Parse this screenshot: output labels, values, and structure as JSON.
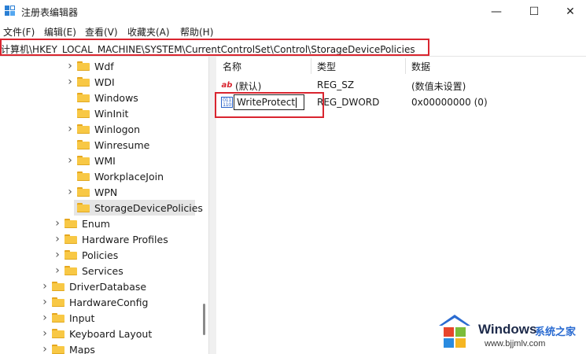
{
  "window": {
    "title": "注册表编辑器",
    "minimize_symbol": "—",
    "maximize_symbol": "☐",
    "close_symbol": "✕"
  },
  "menu": [
    "文件(F)",
    "编辑(E)",
    "查看(V)",
    "收藏夹(A)",
    "帮助(H)"
  ],
  "address": {
    "path": "计算机\\HKEY_LOCAL_MACHINE\\SYSTEM\\CurrentControlSet\\Control\\StorageDevicePolicies"
  },
  "tree": [
    {
      "label": "Wdf",
      "expandable": true
    },
    {
      "label": "WDI",
      "expandable": true
    },
    {
      "label": "Windows",
      "expandable": false
    },
    {
      "label": "WinInit",
      "expandable": false
    },
    {
      "label": "Winlogon",
      "expandable": true
    },
    {
      "label": "Winresume",
      "expandable": false
    },
    {
      "label": "WMI",
      "expandable": true
    },
    {
      "label": "WorkplaceJoin",
      "expandable": false
    },
    {
      "label": "WPN",
      "expandable": true
    },
    {
      "label": "StorageDevicePolicies",
      "expandable": false,
      "selected": true
    },
    {
      "label": "Enum",
      "expandable": true
    },
    {
      "label": "Hardware Profiles",
      "expandable": true
    },
    {
      "label": "Policies",
      "expandable": true
    },
    {
      "label": "Services",
      "expandable": true
    },
    {
      "label": "DriverDatabase",
      "expandable": true
    },
    {
      "label": "HardwareConfig",
      "expandable": true
    },
    {
      "label": "Input",
      "expandable": true
    },
    {
      "label": "Keyboard Layout",
      "expandable": true
    },
    {
      "label": "Maps",
      "expandable": true
    }
  ],
  "values_pane": {
    "columns": [
      "名称",
      "类型",
      "数据"
    ],
    "rows": [
      {
        "icon": "string-value-icon",
        "icon_text": "ab",
        "name": "(默认)",
        "type": "REG_SZ",
        "data": "(数值未设置)"
      },
      {
        "icon": "binary-value-icon",
        "icon_text": "011\n110",
        "name": "WriteProtect",
        "type": "REG_DWORD",
        "data": "0x00000000 (0)",
        "editing": true
      }
    ]
  },
  "watermark": {
    "brand": "Windows",
    "cn_text": "系统之家",
    "url": "www.bjjmlv.com"
  },
  "colors": {
    "highlight_red": "#d9252f",
    "folder_yellow": "#f8c845",
    "selection_gray": "#e5e5e5"
  }
}
